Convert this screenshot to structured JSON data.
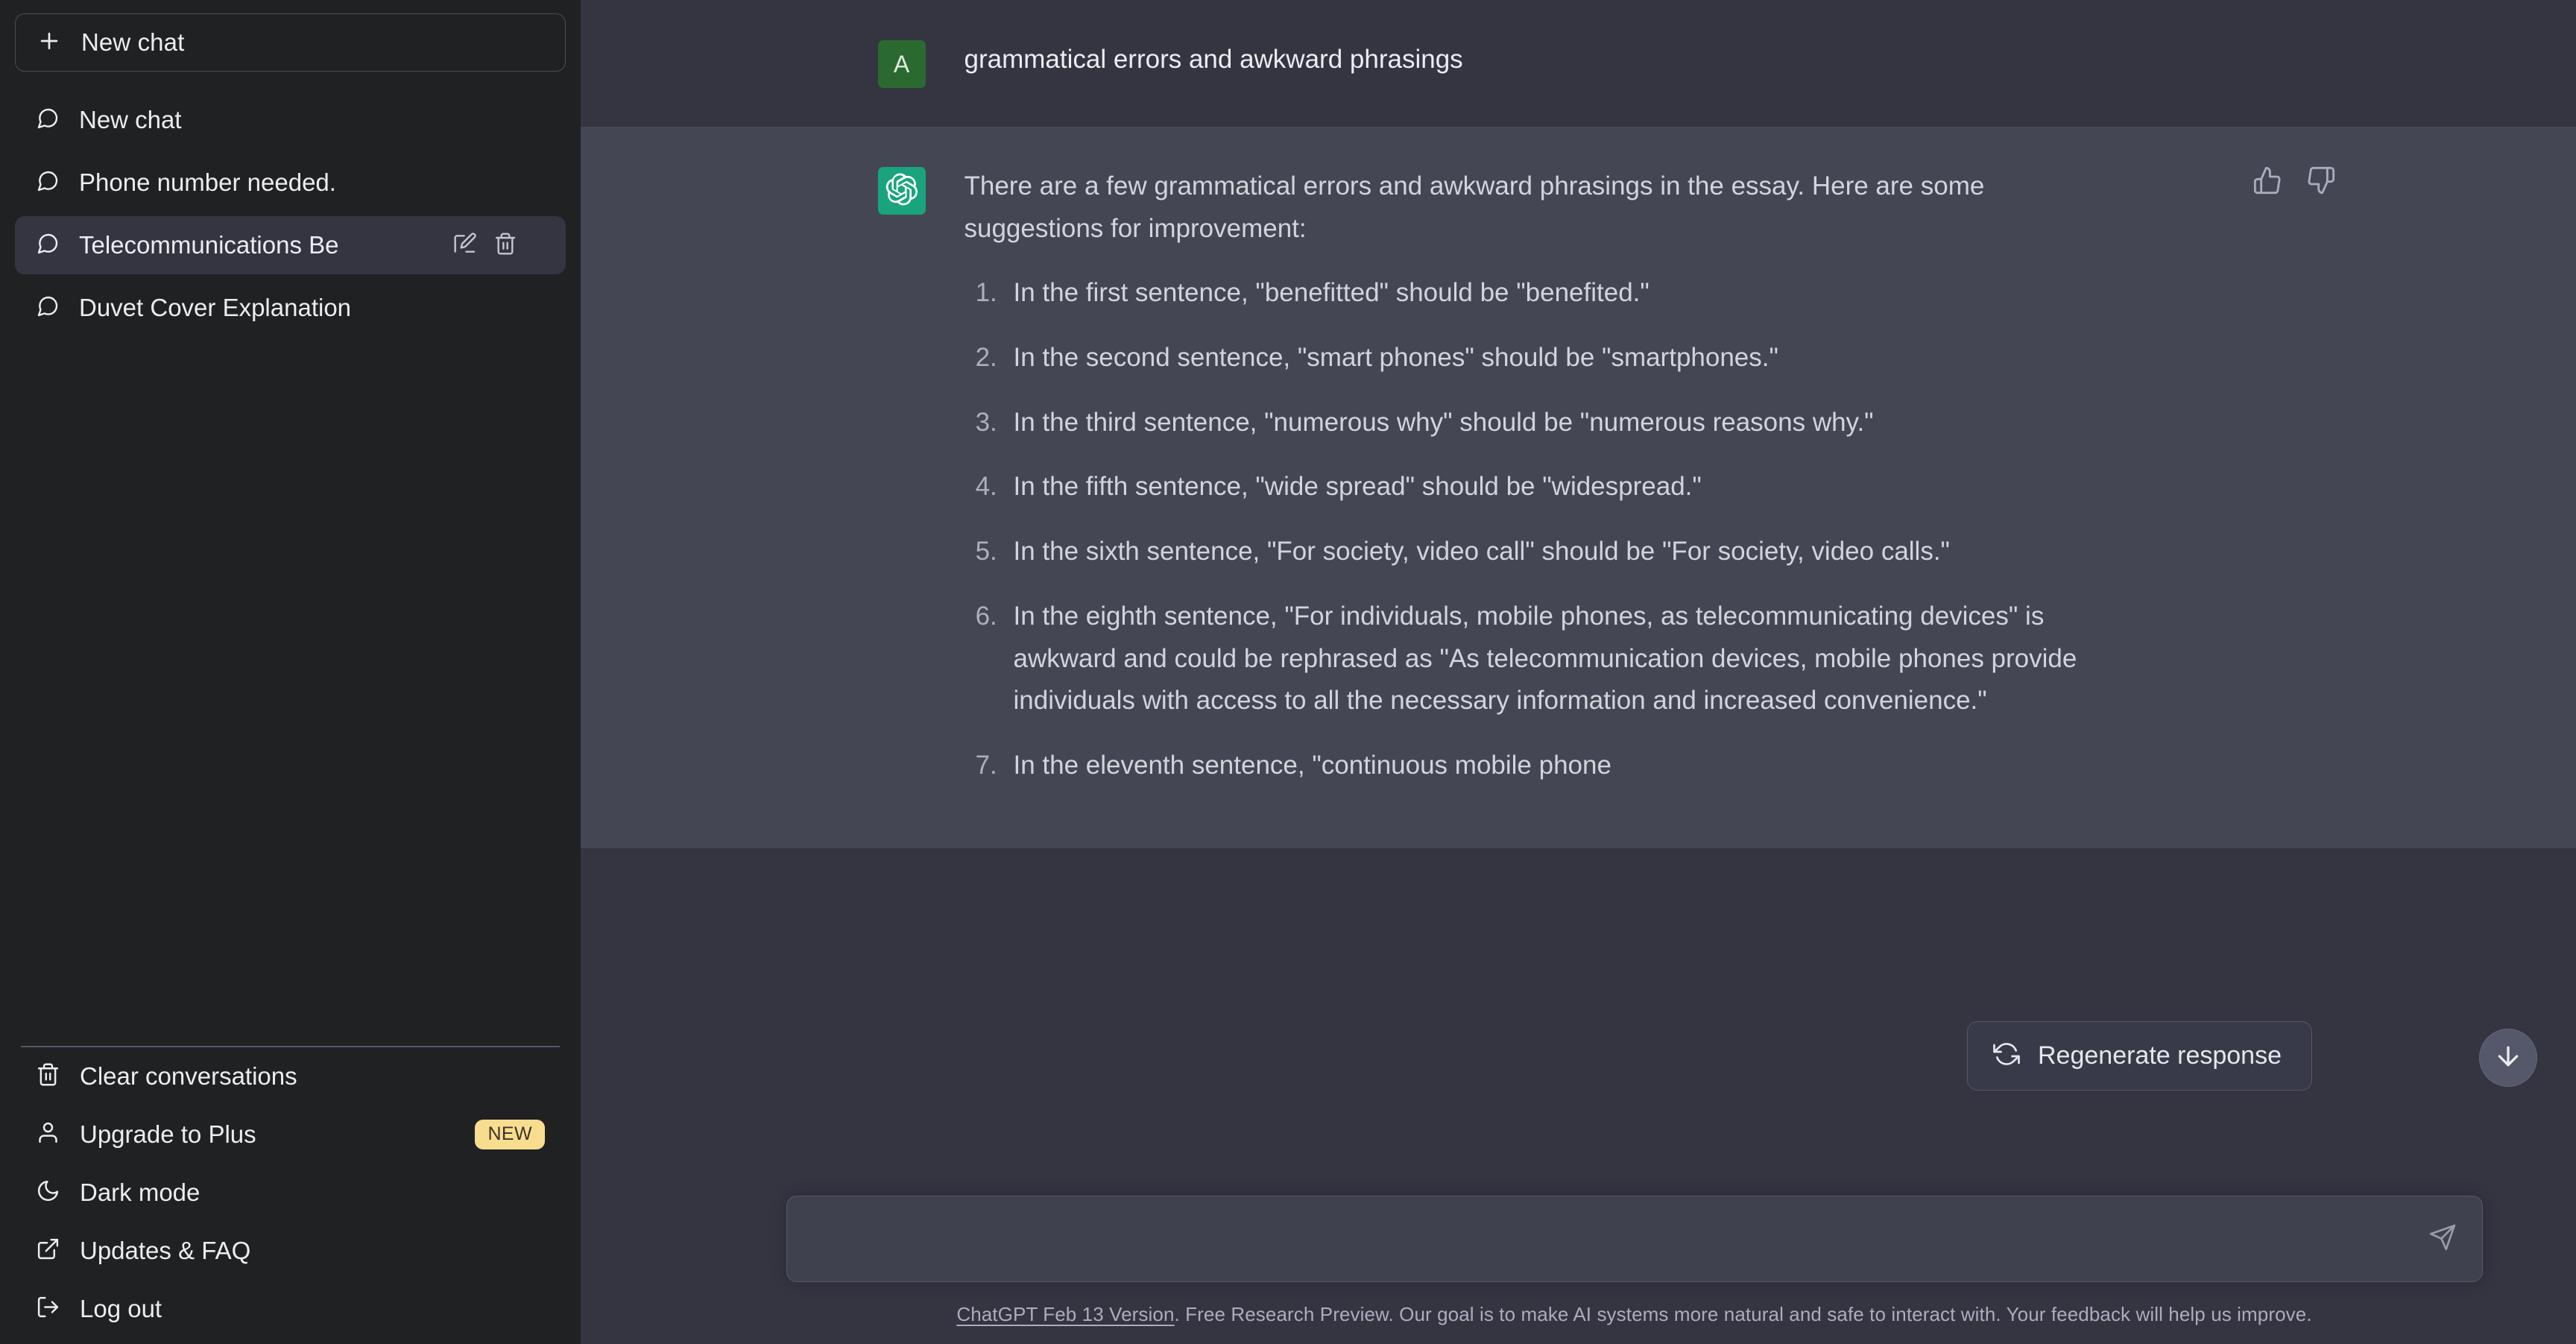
{
  "sidebar": {
    "new_chat": {
      "label": "New chat",
      "icon": "plus-icon"
    },
    "conversations": [
      {
        "title": "New chat",
        "icon": "chat-bubble-icon",
        "active": false
      },
      {
        "title": "Phone number needed.",
        "icon": "chat-bubble-icon",
        "active": false
      },
      {
        "title": "Telecommunications Be",
        "icon": "chat-bubble-icon",
        "active": true,
        "actions": [
          {
            "name": "edit-icon",
            "label": "Edit"
          },
          {
            "name": "trash-icon",
            "label": "Delete"
          }
        ]
      },
      {
        "title": "Duvet Cover Explanation",
        "icon": "chat-bubble-icon",
        "active": false
      }
    ],
    "menu": [
      {
        "label": "Clear conversations",
        "icon": "trash-icon"
      },
      {
        "label": "Upgrade to Plus",
        "icon": "user-icon",
        "badge": "NEW"
      },
      {
        "label": "Dark mode",
        "icon": "moon-icon"
      },
      {
        "label": "Updates & FAQ",
        "icon": "external-link-icon"
      },
      {
        "label": "Log out",
        "icon": "logout-icon"
      }
    ]
  },
  "thread": {
    "user_message": {
      "avatar_initial": "A",
      "text": "grammatical errors and awkward phrasings"
    },
    "assistant_message": {
      "avatar": "openai-logo-icon",
      "intro": "There are a few grammatical errors and awkward phrasings in the essay. Here are some suggestions for improvement:",
      "items": [
        "In the first sentence, \"benefitted\" should be \"benefited.\"",
        "In the second sentence, \"smart phones\" should be \"smartphones.\"",
        "In the third sentence, \"numerous why\" should be \"numerous reasons why.\"",
        "In the fifth sentence, \"wide spread\" should be \"widespread.\"",
        "In the sixth sentence, \"For society, video call\" should be \"For society, video calls.\"",
        "In the eighth sentence, \"For individuals, mobile phones, as telecommunicating devices\" is awkward and could be rephrased as \"As telecommunication devices, mobile phones provide individuals with access to all the necessary information and increased convenience.\"",
        "In the eleventh sentence, \"continuous mobile phone"
      ],
      "feedback": [
        {
          "name": "thumbs-up-icon",
          "label": "Good response"
        },
        {
          "name": "thumbs-down-icon",
          "label": "Bad response"
        }
      ]
    }
  },
  "controls": {
    "regenerate": {
      "label": "Regenerate response",
      "icon": "refresh-icon"
    },
    "scroll_to_bottom": {
      "icon": "arrow-down-icon"
    },
    "composer": {
      "value": "",
      "placeholder": "",
      "send_icon": "send-icon"
    }
  },
  "footer": {
    "link_text": "ChatGPT Feb 13 Version",
    "rest_text": ". Free Research Preview. Our goal is to make AI systems more natural and safe to interact with. Your feedback will help us improve."
  },
  "colors": {
    "sidebar_bg": "#202123",
    "user_row_bg": "#343541",
    "assistant_row_bg": "#444654",
    "user_avatar": "#2a6a30",
    "bot_avatar": "#19a47d",
    "badge_new": "#f9dd8f",
    "text_primary": "#ececf1",
    "text_secondary": "#d1d5db"
  }
}
